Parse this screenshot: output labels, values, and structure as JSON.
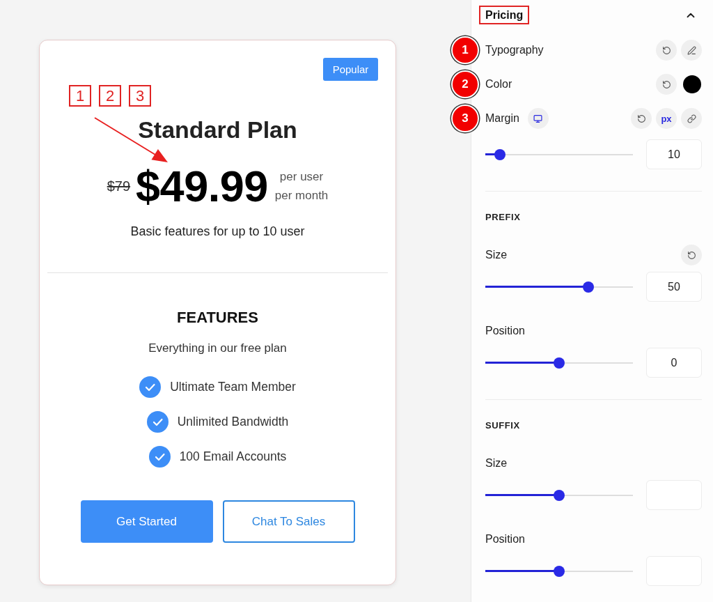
{
  "annotations": [
    "1",
    "2",
    "3"
  ],
  "pricing_card": {
    "badge": "Popular",
    "title": "Standard Plan",
    "old_price": "$79",
    "price": "$49.99",
    "period": [
      "per user",
      "per month"
    ],
    "description": "Basic features for up to 10 user",
    "features_title": "FEATURES",
    "features_subtitle": "Everything in our free plan",
    "features": [
      "Ultimate Team Member",
      "Unlimited Bandwidth",
      "100 Email Accounts"
    ],
    "buttons": [
      {
        "label": "Get Started",
        "kind": "primary"
      },
      {
        "label": "Chat To Sales",
        "kind": "outline"
      }
    ]
  },
  "panel": {
    "title": "Pricing",
    "expanded": true,
    "rows": [
      {
        "label": "Typography",
        "kind": "typography",
        "marker": "1"
      },
      {
        "label": "Color",
        "kind": "color",
        "marker": "2",
        "color": "#000000"
      },
      {
        "label": "Margin",
        "kind": "margin",
        "marker": "3",
        "unit": "px",
        "level": 0.1,
        "value": "10"
      }
    ],
    "sections": [
      {
        "heading": "PREFIX",
        "controls": [
          {
            "label": "Size",
            "reset": true,
            "level": 0.7,
            "value": "50"
          },
          {
            "label": "Position",
            "reset": false,
            "level": 0.5,
            "value": "0"
          }
        ]
      },
      {
        "heading": "SUFFIX",
        "controls": [
          {
            "label": "Size",
            "reset": false,
            "level": 0.5
          },
          {
            "label": "Position",
            "reset": false,
            "level": 0.5
          }
        ]
      }
    ]
  }
}
